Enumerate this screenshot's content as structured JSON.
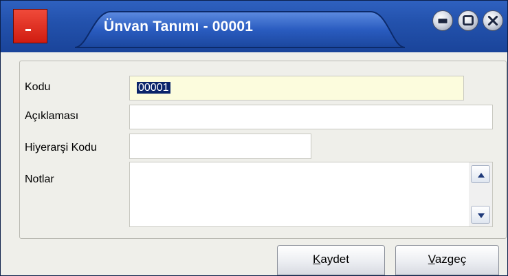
{
  "window": {
    "title": "Ünvan Tanımı - 00001",
    "controls": [
      "minimize-icon",
      "maximize-icon",
      "close-icon"
    ],
    "accent": "#2352ad"
  },
  "form": {
    "kodu": {
      "label": "Kodu",
      "value": "00001"
    },
    "aciklamasi": {
      "label": "Açıklaması",
      "value": ""
    },
    "hiyerarsi_kodu": {
      "label": "Hiyerarşi Kodu",
      "value": ""
    },
    "notlar": {
      "label": "Notlar",
      "value": ""
    }
  },
  "buttons": {
    "save_mnemonic": "K",
    "save_rest": "aydet",
    "cancel_mnemonic": "V",
    "cancel_rest": "azgeç"
  }
}
